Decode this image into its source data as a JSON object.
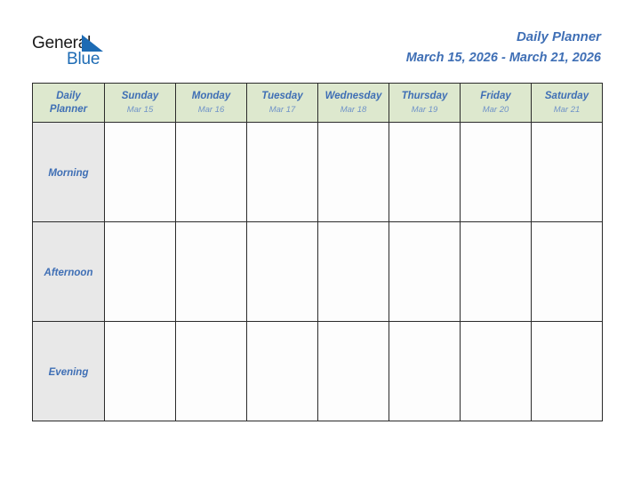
{
  "brand": {
    "word_one": "General",
    "word_two": "Blue",
    "triangle_icon": "triangle-icon",
    "color_dark": "#1a1a1a",
    "color_blue": "#1d6bb4"
  },
  "header": {
    "title": "Daily Planner",
    "date_range": "March 15, 2026 - March 21, 2026",
    "title_color": "#3f6fb5"
  },
  "table": {
    "corner_line_1": "Daily",
    "corner_line_2": "Planner",
    "header_bg": "#dde8ce",
    "row_label_bg": "#e8e8e8",
    "cell_bg": "#fdfdfd",
    "border_color": "#2b2b2b",
    "columns": [
      {
        "day": "Sunday",
        "date": "Mar 15"
      },
      {
        "day": "Monday",
        "date": "Mar 16"
      },
      {
        "day": "Tuesday",
        "date": "Mar 17"
      },
      {
        "day": "Wednesday",
        "date": "Mar 18"
      },
      {
        "day": "Thursday",
        "date": "Mar 19"
      },
      {
        "day": "Friday",
        "date": "Mar 20"
      },
      {
        "day": "Saturday",
        "date": "Mar 21"
      }
    ],
    "rows": [
      {
        "label": "Morning",
        "entries": [
          "",
          "",
          "",
          "",
          "",
          "",
          ""
        ]
      },
      {
        "label": "Afternoon",
        "entries": [
          "",
          "",
          "",
          "",
          "",
          "",
          ""
        ]
      },
      {
        "label": "Evening",
        "entries": [
          "",
          "",
          "",
          "",
          "",
          "",
          ""
        ]
      }
    ]
  }
}
